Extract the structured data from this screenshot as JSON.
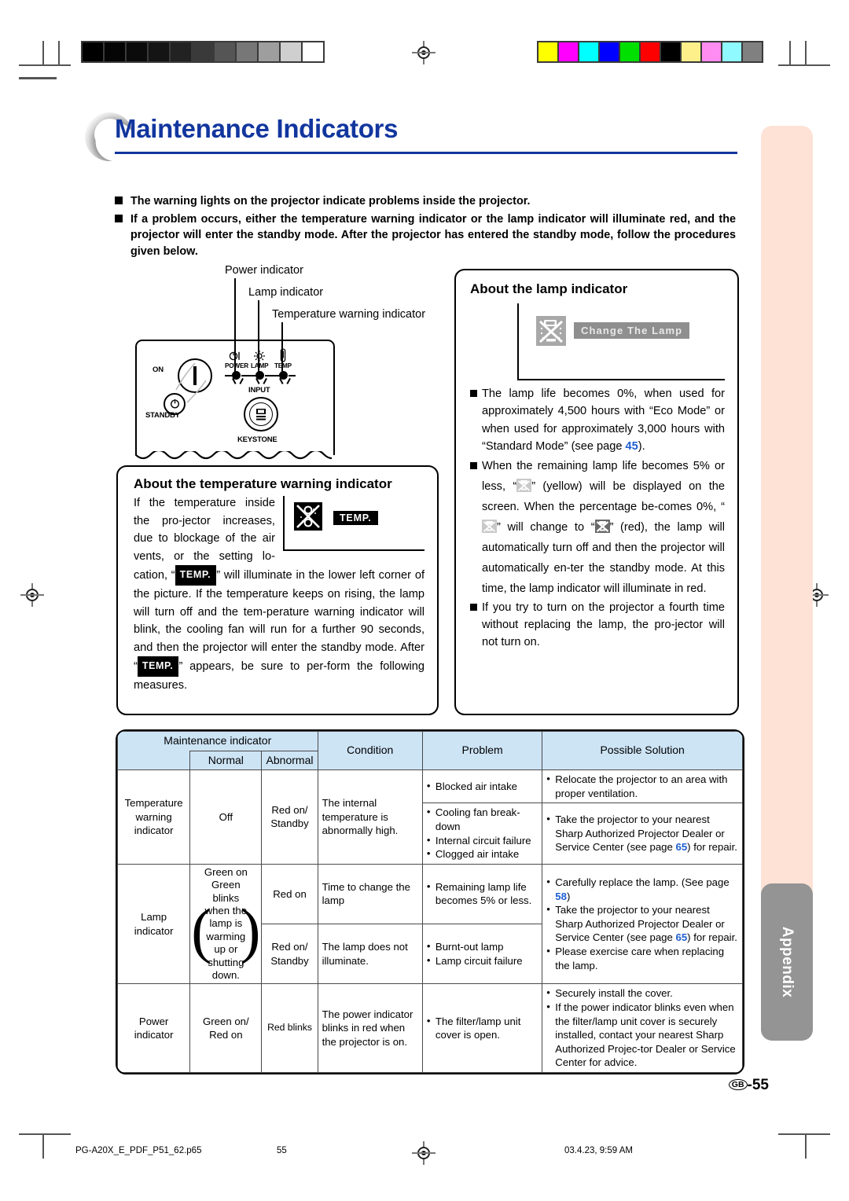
{
  "document": {
    "title": "Maintenance Indicators",
    "page_label": "55",
    "page_region_code": "GB",
    "footer": {
      "filename": "PG-A20X_E_PDF_P51_62.p65",
      "page_number": "55",
      "timestamp": "03.4.23, 9:59 AM"
    },
    "side_tab": "Appendix"
  },
  "intro_bullets": [
    "The warning lights on the projector indicate problems inside the projector.",
    "If a problem occurs, either the temperature warning indicator or the lamp indicator will illuminate red, and the projector will enter the standby mode. After the projector has entered the standby mode, follow the procedures given below."
  ],
  "diagram": {
    "callouts": [
      "Power indicator",
      "Lamp indicator",
      "Temperature warning indicator"
    ],
    "panel_labels": {
      "on": "ON",
      "standby": "STANDBY",
      "power": "POWER",
      "lamp": "LAMP",
      "temp": "TEMP",
      "input": "INPUT",
      "keystone": "KEYSTONE"
    }
  },
  "temp_box": {
    "heading": "About the temperature warning indicator",
    "osd_label": "TEMP.",
    "text_part1": "If the temperature inside the pro-jector increases, due to blockage of the air vents, or the setting lo-cation, “",
    "text_part2": "” will illuminate in the lower left corner of the picture. If the temperature keeps on rising, the lamp will turn off and the tem-perature warning indicator will blink, the cooling fan will run for a further 90 seconds, and then the projector will enter the standby mode. After “",
    "text_part3": "” appears, be sure to per-form the following measures."
  },
  "lamp_box": {
    "heading": "About the lamp indicator",
    "osd_label": "Change The Lamp",
    "bullets": [
      {
        "pre": "The lamp life becomes 0%, when used for approximately 4,500 hours with “Eco Mode” or when used for approximately 3,000 hours with “Standard Mode” (see page ",
        "page": "45",
        "post": ")."
      },
      {
        "seg1": "When the remaining lamp life becomes 5% or less, “",
        "seg2": "” (yellow) will be displayed on the screen. When the percentage be-comes 0%, “",
        "seg3": "” will change to “",
        "seg4": "” (red), the lamp will automatically turn off and then the projector will automatically en-ter the standby mode. At this time, the lamp indicator will illuminate in red."
      },
      {
        "text": "If you try to turn on the projector a fourth time without replacing the lamp, the pro-jector will not turn on."
      }
    ]
  },
  "table": {
    "headers": {
      "group": "Maintenance indicator",
      "normal": "Normal",
      "abnormal": "Abnormal",
      "condition": "Condition",
      "problem": "Problem",
      "solution": "Possible Solution"
    },
    "rows": [
      {
        "indicator": "Temperature warning indicator",
        "normal": "Off",
        "abnormal": "Red on/ Standby",
        "condition": "The internal temperature is abnormally high.",
        "sub": [
          {
            "problems": [
              "Blocked air intake"
            ],
            "solution_items": [
              "Relocate the projector to an area with proper ventilation."
            ]
          },
          {
            "problems": [
              "Cooling fan break-down",
              "Internal circuit failure",
              "Clogged air intake"
            ],
            "solution_pre": "Take the projector to your nearest Sharp Authorized Projector Dealer or Service Center (see page ",
            "solution_page": "65",
            "solution_post": ") for repair."
          }
        ]
      },
      {
        "indicator": "Lamp indicator",
        "normal_main": "Green on",
        "normal_brace": "Green blinks when the lamp is warming up or shutting down.",
        "sub": [
          {
            "abnormal": "Red on",
            "condition": "Time to change the lamp",
            "problems": [
              "Remaining lamp life becomes 5% or less."
            ]
          },
          {
            "abnormal": "Red on/ Standby",
            "condition": "The lamp does not illuminate.",
            "problems": [
              "Burnt-out lamp",
              "Lamp circuit failure"
            ]
          }
        ],
        "solution": {
          "item1_pre": "Carefully replace the lamp. (See page ",
          "item1_page": "58",
          "item1_post": ")",
          "item2_pre": "Take the projector to your nearest Sharp Authorized Projector Dealer or Service Center (see page ",
          "item2_page": "65",
          "item2_post": ") for repair.",
          "item3": "Please exercise care when replacing the lamp."
        }
      },
      {
        "indicator": "Power indicator",
        "normal": "Green on/ Red on",
        "abnormal": "Red blinks",
        "condition": "The power indicator blinks in red when the projector is on.",
        "problems": [
          "The filter/lamp unit cover is open."
        ],
        "solution_items": [
          "Securely install the cover.",
          "If the power indicator blinks even when the filter/lamp unit cover is securely installed, contact your nearest Sharp Authorized Projec-tor Dealer or Service Center for advice."
        ]
      }
    ]
  },
  "colors": {
    "title_blue": "#12369e",
    "page_link_blue": "#1f5fd0",
    "table_header_blue": "#cde4f5",
    "side_peach": "#fde2d5",
    "tab_gray": "#949494",
    "gray_bar": [
      "#000000",
      "#050505",
      "#0b0b0b",
      "#141414",
      "#222222",
      "#3a3a3a",
      "#555555",
      "#777777",
      "#9e9e9e",
      "#cfcfcf",
      "#ffffff"
    ],
    "color_bar": [
      "#ffff00",
      "#ff00ff",
      "#00ffff",
      "#0000ff",
      "#00e000",
      "#ff0000",
      "#000000",
      "#fdf08a",
      "#ff8cf0",
      "#8ffaff",
      "#808080"
    ]
  }
}
